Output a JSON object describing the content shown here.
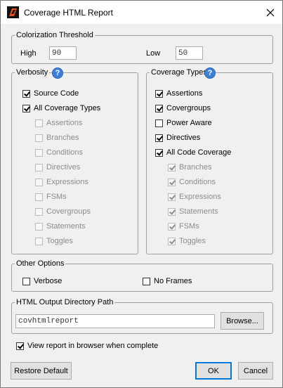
{
  "window": {
    "title": "Coverage HTML Report"
  },
  "threshold": {
    "legend": "Colorization Threshold",
    "high_label": "High",
    "high_value": "90",
    "low_label": "Low",
    "low_value": "50"
  },
  "verbosity": {
    "legend": "Verbosity",
    "help": "?",
    "source_code": "Source Code",
    "all_coverage_types": "All Coverage Types",
    "sub_items": [
      "Assertions",
      "Branches",
      "Conditions",
      "Directives",
      "Expressions",
      "FSMs",
      "Covergroups",
      "Statements",
      "Toggles"
    ]
  },
  "coverage_types": {
    "legend": "Coverage Types",
    "help": "?",
    "assertions": "Assertions",
    "covergroups": "Covergroups",
    "power_aware": "Power Aware",
    "directives": "Directives",
    "all_code_coverage": "All Code Coverage",
    "sub_items": [
      "Branches",
      "Conditions",
      "Expressions",
      "Statements",
      "FSMs",
      "Toggles"
    ]
  },
  "other_options": {
    "legend": "Other Options",
    "verbose": "Verbose",
    "no_frames": "No Frames"
  },
  "output_dir": {
    "legend": "HTML Output Directory Path",
    "value": "covhtmlreport",
    "browse": "Browse..."
  },
  "view_report": "View report in browser when complete",
  "buttons": {
    "restore_default": "Restore Default",
    "ok": "OK",
    "cancel": "Cancel"
  }
}
